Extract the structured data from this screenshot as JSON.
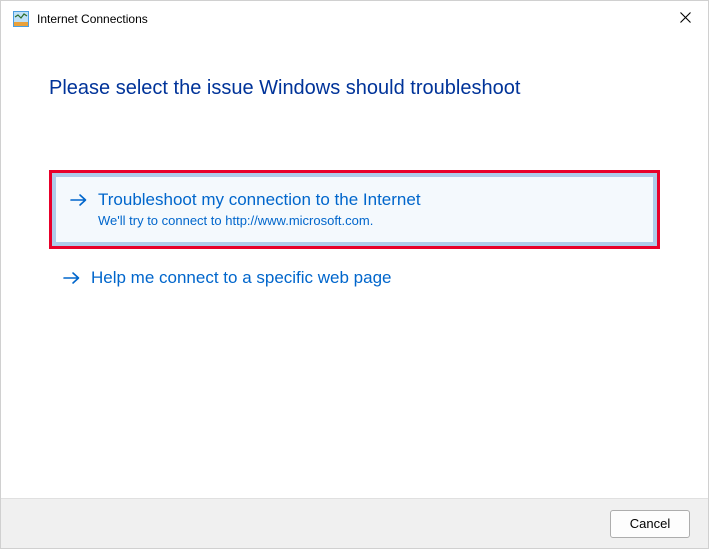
{
  "window": {
    "title": "Internet Connections"
  },
  "heading": "Please select the issue Windows should troubleshoot",
  "options": [
    {
      "title": "Troubleshoot my connection to the Internet",
      "description": "We'll try to connect to http://www.microsoft.com."
    },
    {
      "title": "Help me connect to a specific web page",
      "description": ""
    }
  ],
  "footer": {
    "cancel": "Cancel"
  }
}
